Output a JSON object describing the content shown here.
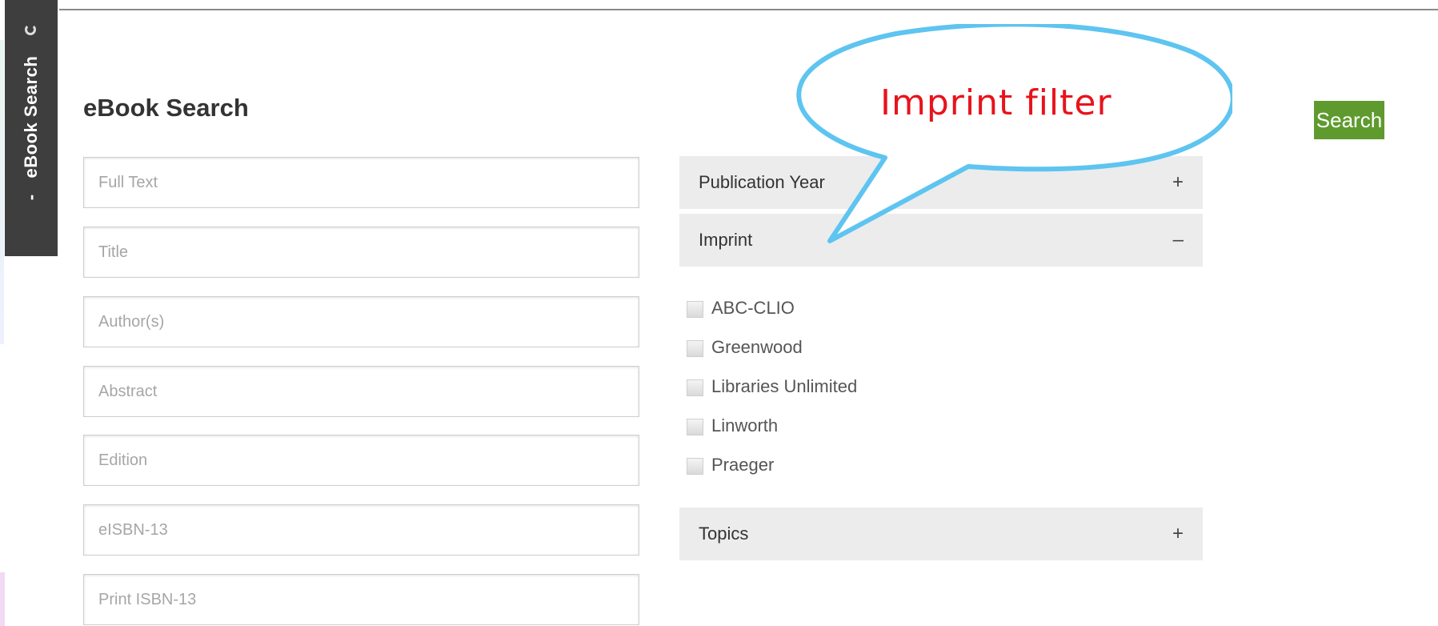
{
  "sidebar_tab": {
    "label": "eBook Search",
    "collapse_glyph": "-",
    "icon": "refresh-icon"
  },
  "page": {
    "title": "eBook Search"
  },
  "fields": [
    {
      "placeholder": "Full Text",
      "value": ""
    },
    {
      "placeholder": "Title",
      "value": ""
    },
    {
      "placeholder": "Author(s)",
      "value": ""
    },
    {
      "placeholder": "Abstract",
      "value": ""
    },
    {
      "placeholder": "Edition",
      "value": ""
    },
    {
      "placeholder": "eISBN-13",
      "value": ""
    },
    {
      "placeholder": "Print ISBN-13",
      "value": ""
    }
  ],
  "facets": {
    "publication_year": {
      "label": "Publication Year",
      "toggle": "+"
    },
    "imprint": {
      "label": "Imprint",
      "toggle": "–",
      "options": [
        "ABC-CLIO",
        "Greenwood",
        "Libraries Unlimited",
        "Linworth",
        "Praeger"
      ]
    },
    "topics": {
      "label": "Topics",
      "toggle": "+"
    }
  },
  "search_button": {
    "label": "Search"
  },
  "annotation": {
    "text": "Imprint filter"
  },
  "colors": {
    "sidebar_bg": "#3e3e3e",
    "search_button_bg": "#5f9a2e",
    "accordion_bg": "#ececec",
    "callout_stroke": "#5ec4f0",
    "callout_text": "#e8131b"
  }
}
